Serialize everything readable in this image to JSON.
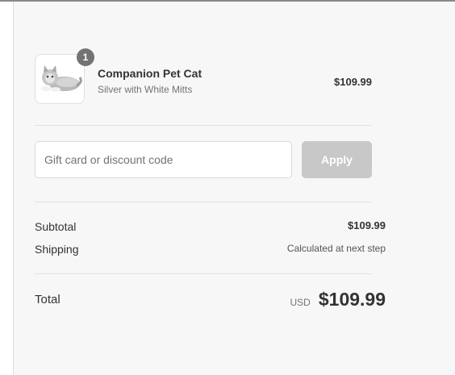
{
  "order": {
    "item": {
      "quantity": "1",
      "name": "Companion Pet Cat",
      "variant": "Silver with White Mitts",
      "price": "$109.99",
      "image_alt": "Companion Pet Cat"
    }
  },
  "discount": {
    "placeholder": "Gift card or discount code",
    "apply_label": "Apply"
  },
  "summary": {
    "subtotal_label": "Subtotal",
    "subtotal_value": "$109.99",
    "shipping_label": "Shipping",
    "shipping_value": "Calculated at next step",
    "total_label": "Total",
    "currency": "USD",
    "total_value": "$109.99"
  }
}
